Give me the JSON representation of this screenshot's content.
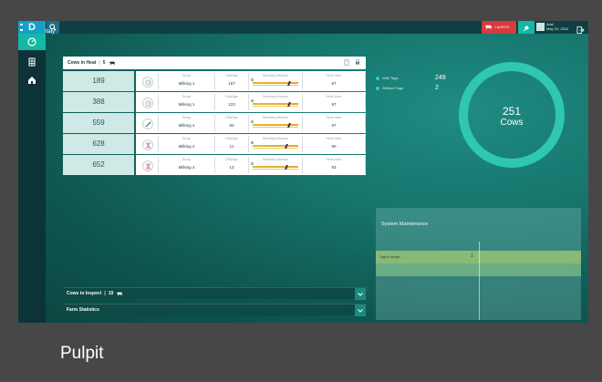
{
  "app": {
    "logo_text": "D"
  },
  "topbar": {
    "alerts_label": "1 ALERTS",
    "user_name": "Ariel",
    "user_date": "May 23, 2022"
  },
  "sidebar": {
    "items": [
      {
        "icon": "gauge-icon",
        "active": true
      },
      {
        "icon": "building-icon",
        "active": false
      },
      {
        "icon": "barn-icon",
        "active": false
      }
    ]
  },
  "main": {
    "country": "Italy",
    "heat": {
      "title": "Cows in Heat",
      "count": "5",
      "columns": {
        "group": "Group",
        "dim_age": "DIM/Age",
        "breeding": "Breeding Window",
        "heat_index": "Heat Index"
      },
      "rows": [
        {
          "cow": "189",
          "status": "pending",
          "group": "Milking 1",
          "dim": "167",
          "heat_index": "97",
          "window_mark": 0.78
        },
        {
          "cow": "388",
          "status": "pending",
          "group": "Milking 1",
          "dim": "123",
          "heat_index": "97",
          "window_mark": 0.78
        },
        {
          "cow": "559",
          "status": "inseminated",
          "group": "Milking 4",
          "dim": "60",
          "heat_index": "97",
          "window_mark": 0.78
        },
        {
          "cow": "628",
          "status": "timer",
          "group": "Milking 4",
          "dim": "11",
          "heat_index": "90",
          "window_mark": 0.72
        },
        {
          "cow": "652",
          "status": "timer",
          "group": "Milking 4",
          "dim": "13",
          "heat_index": "93",
          "window_mark": 0.72
        }
      ]
    },
    "tags": {
      "with_tags_label": "With Tags",
      "with_tags": "249",
      "without_tags_label": "Without Tags",
      "without_tags": "2",
      "total": "251",
      "total_label": "Cows"
    },
    "system": {
      "title": "System Maintenance",
      "row_label": "Tags to Assign",
      "row_value": "1"
    },
    "inspect": {
      "label": "Cows to Inspect",
      "count": "19"
    },
    "farm_stats": {
      "label": "Farm Statistics"
    }
  },
  "caption": "Pulpit",
  "colors": {
    "accent": "#14b8a4",
    "alert": "#d93a3a",
    "logo": "#14a0c8",
    "sidebar": "#0c3338"
  }
}
